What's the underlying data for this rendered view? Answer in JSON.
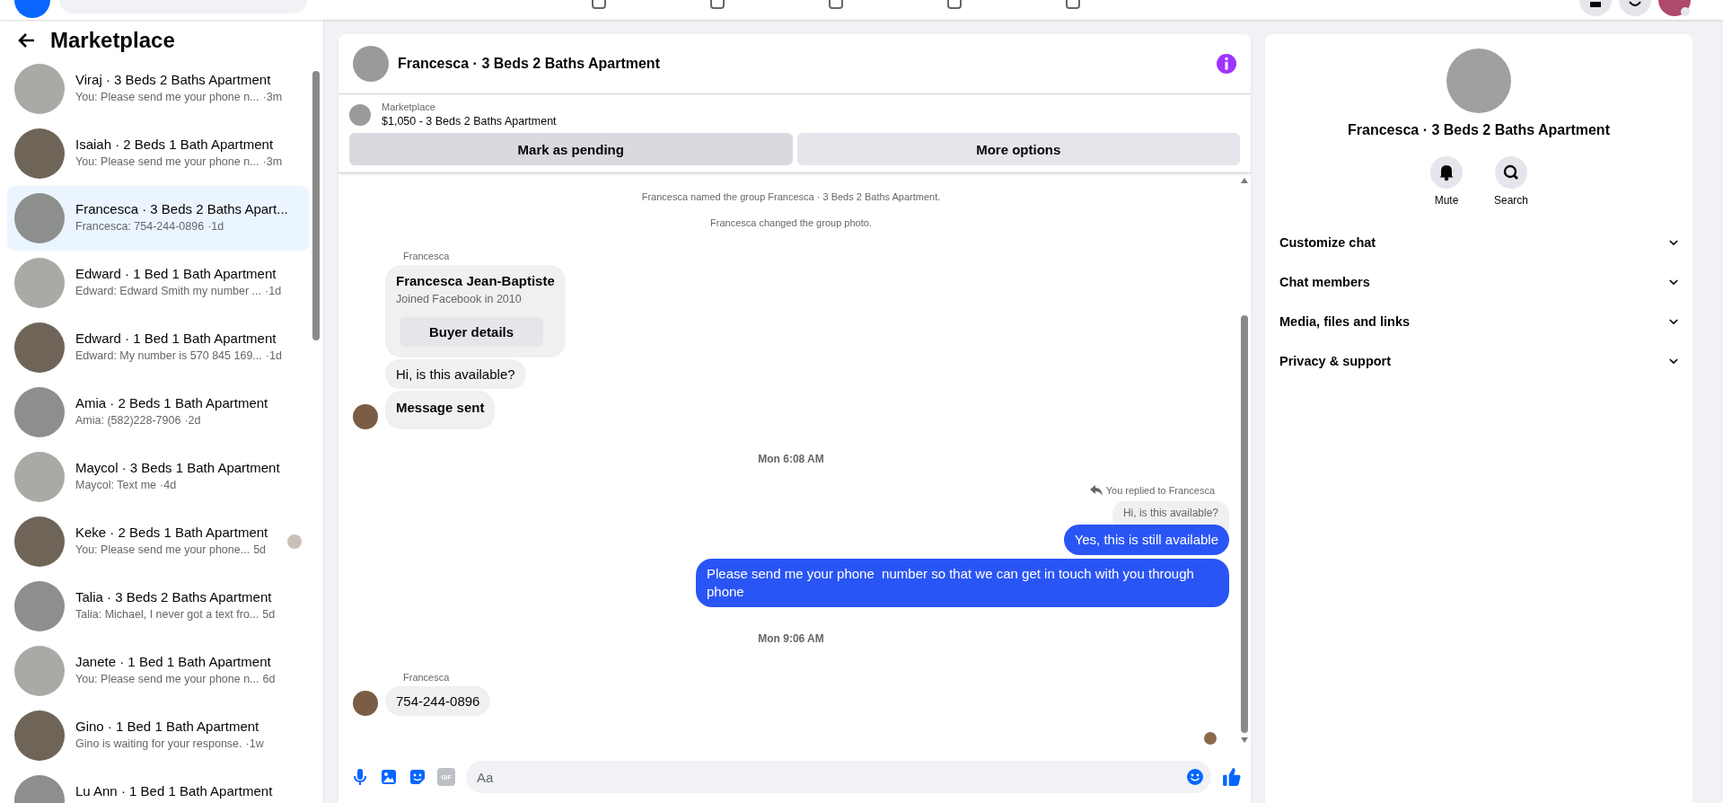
{
  "sidebar": {
    "title": "Marketplace",
    "conversations": [
      {
        "name": "Viraj · 3 Beds 2 Baths Apartment",
        "preview": "You: Please send me your phone n...",
        "time": "·3m",
        "selected": false,
        "seen": false
      },
      {
        "name": "Isaiah · 2 Beds 1 Bath Apartment",
        "preview": "You: Please send me your phone n...",
        "time": "·3m",
        "selected": false,
        "seen": false
      },
      {
        "name": "Francesca · 3 Beds 2 Baths Apart...",
        "preview": "Francesca: 754-244-0896",
        "time": "·1d",
        "selected": true,
        "seen": false
      },
      {
        "name": "Edward · 1 Bed 1 Bath Apartment",
        "preview": "Edward: Edward Smith my number ...",
        "time": "·1d",
        "selected": false,
        "seen": false
      },
      {
        "name": "Edward · 1 Bed 1 Bath Apartment",
        "preview": "Edward: My number is 570 845 169...",
        "time": "·1d",
        "selected": false,
        "seen": false
      },
      {
        "name": "Amia · 2 Beds 1 Bath Apartment",
        "preview": "Amia: (582)228-7906",
        "time": "·2d",
        "selected": false,
        "seen": false
      },
      {
        "name": "Maycol · 3 Beds 1 Bath Apartment",
        "preview": "Maycol: Text me",
        "time": "·4d",
        "selected": false,
        "seen": false
      },
      {
        "name": "Keke · 2 Beds 1 Bath Apartment",
        "preview": "You: Please send me your phone...",
        "time": "5d",
        "selected": false,
        "seen": true
      },
      {
        "name": "Talia · 3 Beds 2 Baths Apartment",
        "preview": "Talia: Michael, I never got a text fro...",
        "time": "5d",
        "selected": false,
        "seen": false
      },
      {
        "name": "Janete · 1 Bed 1 Bath Apartment",
        "preview": "You: Please send me your phone n...",
        "time": "6d",
        "selected": false,
        "seen": false
      },
      {
        "name": "Gino · 1 Bed 1 Bath Apartment",
        "preview": "Gino is waiting for your response.",
        "time": "·1w",
        "selected": false,
        "seen": false
      },
      {
        "name": "Lu Ann · 1 Bed 1 Bath Apartment",
        "selected": false,
        "seen": false
      }
    ]
  },
  "chat": {
    "title": "Francesca · 3 Beds 2 Baths Apartment",
    "listing": {
      "label": "Marketplace",
      "title": "$1,050 - 3 Beds 2 Baths Apartment"
    },
    "buttons": [
      {
        "label": "Mark as pending",
        "hovered": true
      },
      {
        "label": "More options",
        "hovered": false
      }
    ],
    "messages": [
      {
        "kind": "system",
        "text": "Francesca named the group Francesca · 3 Beds 2 Baths Apartment."
      },
      {
        "kind": "system",
        "text": "Francesca changed the group photo."
      },
      {
        "kind": "sender",
        "text": "Francesca"
      },
      {
        "kind": "buyer_card",
        "name": "Francesca Jean-Baptiste",
        "subtitle": "Joined Facebook in 2010",
        "button": "Buyer details"
      },
      {
        "kind": "incoming",
        "text": "Hi, is this available?",
        "avatar": false,
        "bold": false
      },
      {
        "kind": "incoming",
        "text": "Message sent",
        "avatar": true,
        "bold": true
      },
      {
        "kind": "time",
        "text": "Mon 6:08 AM"
      },
      {
        "kind": "reply_label",
        "text": "You replied to Francesca"
      },
      {
        "kind": "quote",
        "text": "Hi, is this available?"
      },
      {
        "kind": "outgoing",
        "text": "Yes, this is still available"
      },
      {
        "kind": "outgoing",
        "text": "Please send me your phone  number so that we can get in touch with you through phone"
      },
      {
        "kind": "time",
        "text": "Mon 9:06 AM"
      },
      {
        "kind": "sender",
        "text": "Francesca"
      },
      {
        "kind": "incoming",
        "text": "754-244-0896",
        "avatar": true,
        "bold": false
      },
      {
        "kind": "seen"
      }
    ],
    "composer": {
      "placeholder": "Aa",
      "gif": "GIF"
    }
  },
  "details": {
    "title": "Francesca · 3 Beds 2 Baths Apartment",
    "actions": [
      {
        "kind": "bell",
        "label": "Mute"
      },
      {
        "kind": "search",
        "label": "Search"
      }
    ],
    "sections": [
      {
        "label": "Customize chat",
        "expanded": false
      },
      {
        "label": "Chat members",
        "expanded": false
      },
      {
        "label": "Media, files and links",
        "expanded": false
      },
      {
        "label": "Privacy & support",
        "expanded": false
      }
    ]
  }
}
